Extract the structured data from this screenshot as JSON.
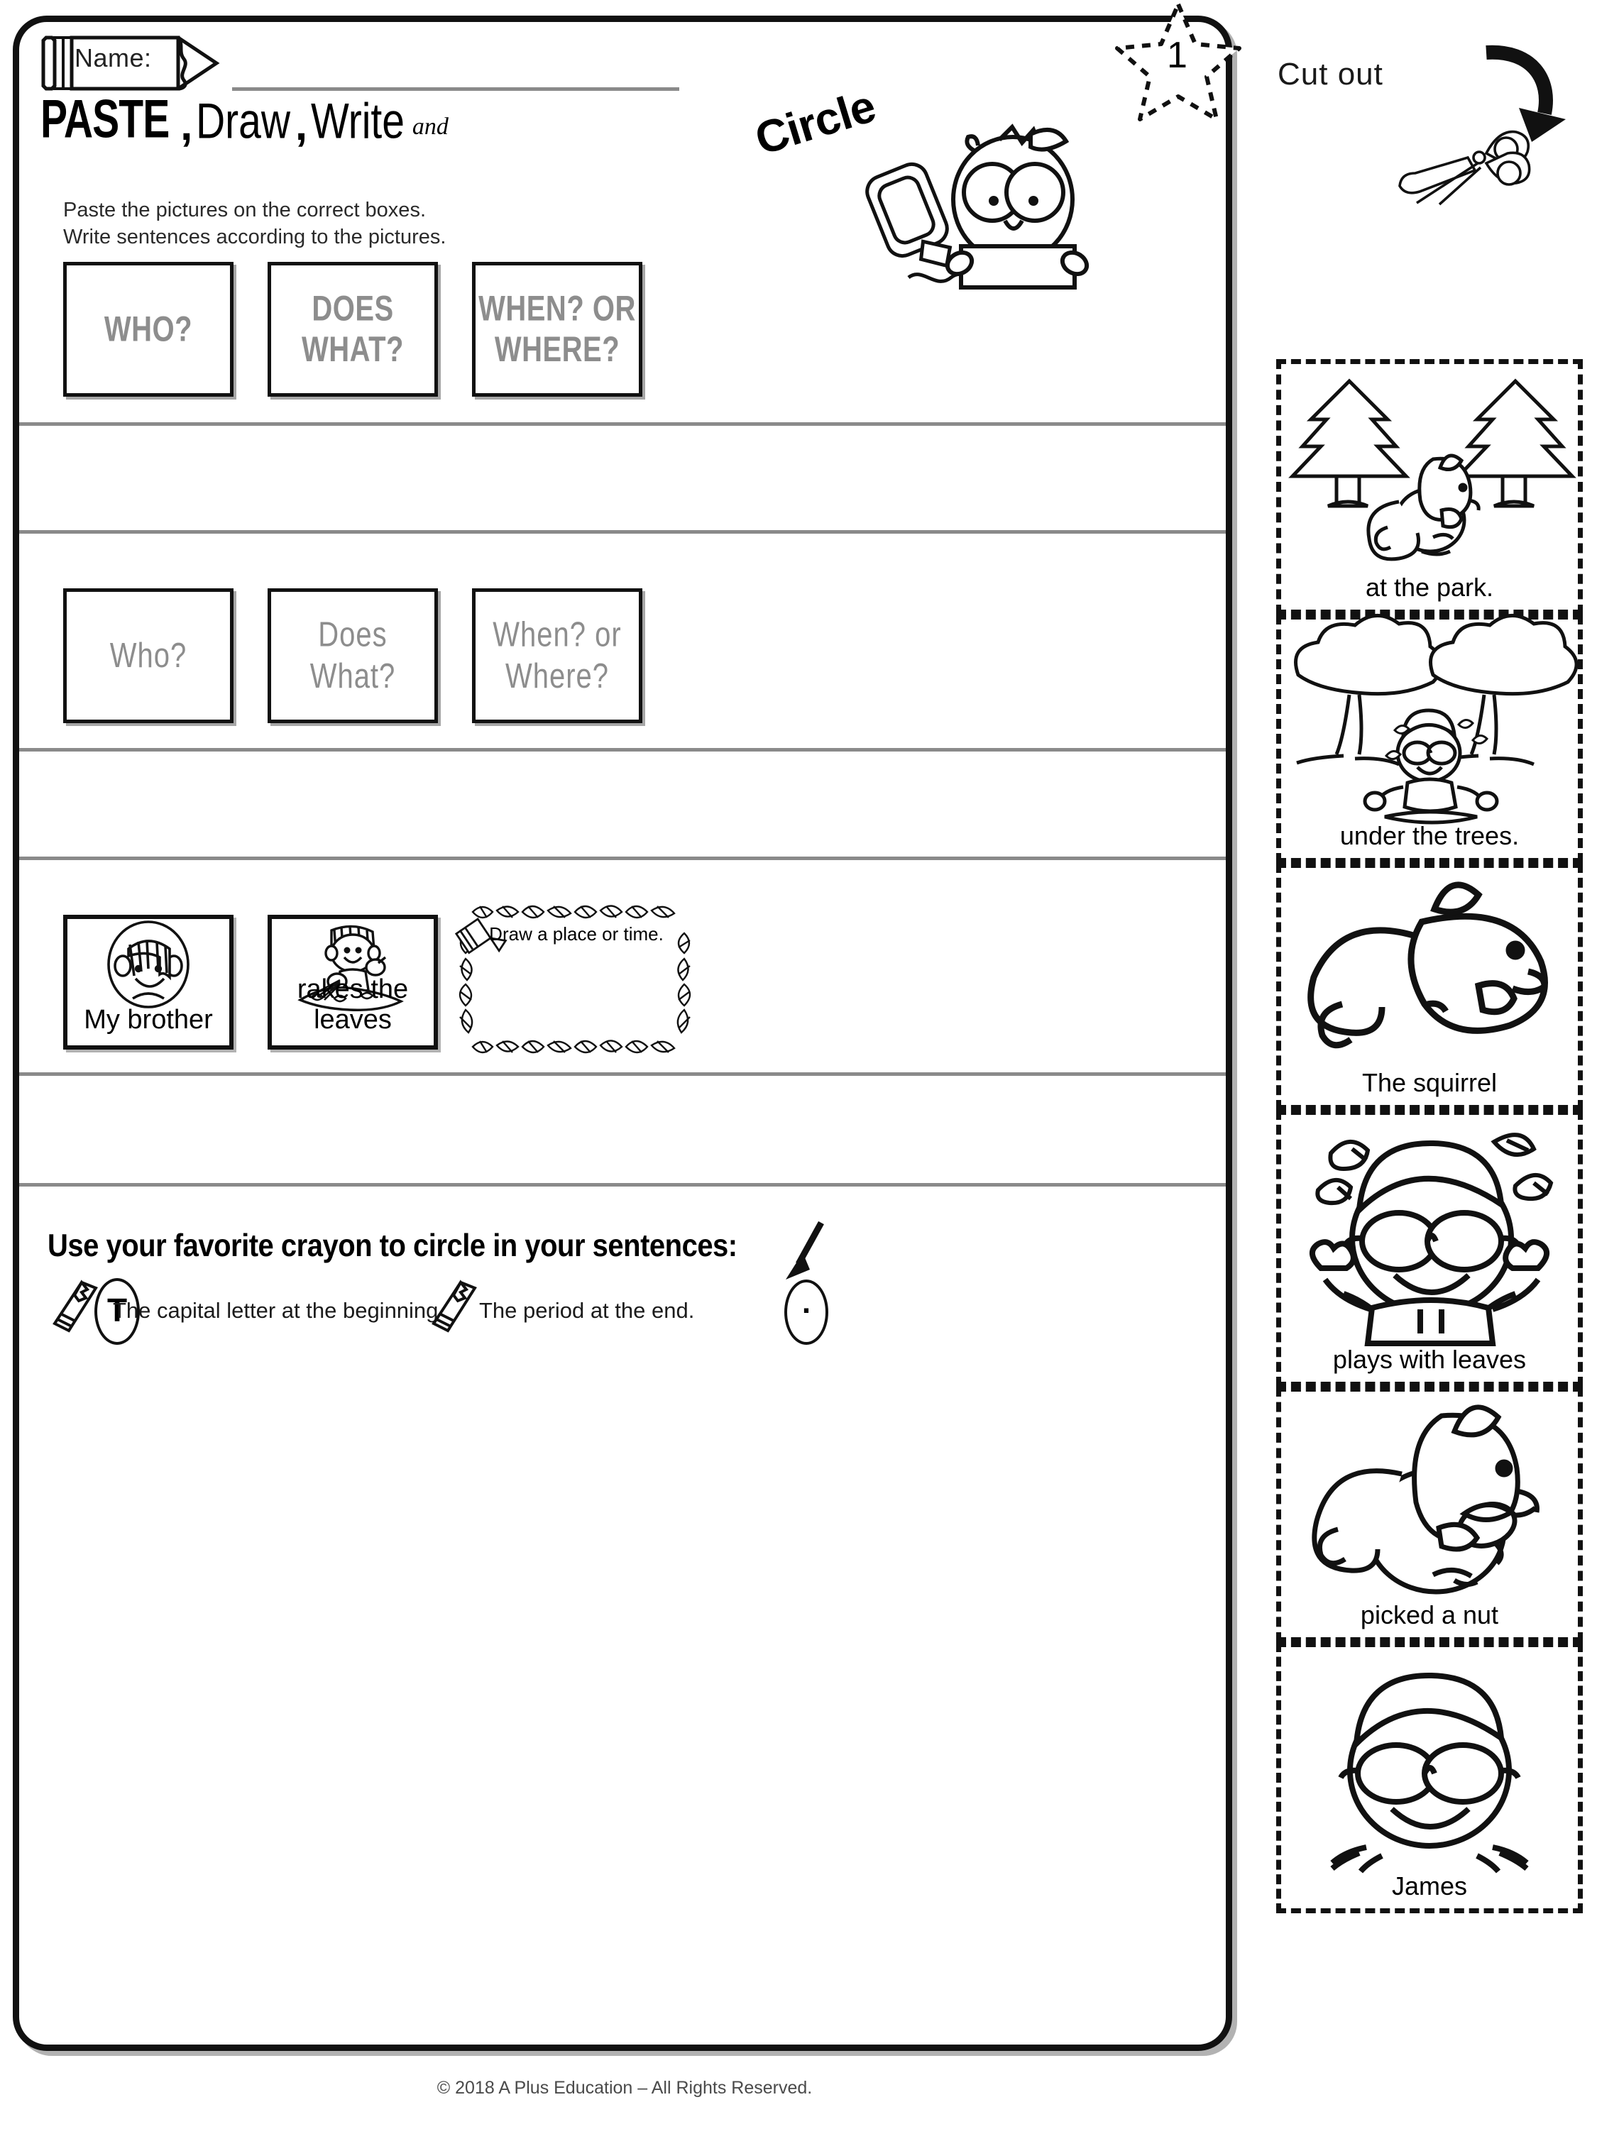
{
  "worksheet": {
    "name_field": {
      "label": "Name:",
      "value": ""
    },
    "title": {
      "word1": "PASTE",
      "comma1": ",",
      "word2": "Draw",
      "comma2": ",",
      "word3": "Write",
      "connector": "and",
      "word4": "Circle"
    },
    "instructions": {
      "line1": "Paste the pictures on the correct boxes.",
      "line2": "Write sentences according to the pictures."
    },
    "page_badge": {
      "number": "1",
      "shape": "star-dashed"
    },
    "category_row_caps": [
      {
        "label": "WHO?"
      },
      {
        "label": "DOES WHAT?"
      },
      {
        "label": "WHEN? OR WHERE?",
        "line1": "WHEN? OR",
        "line2": "WHERE?"
      }
    ],
    "category_row_mixed": [
      {
        "label": "Who?"
      },
      {
        "label": "Does What?"
      },
      {
        "label": "When? or Where?",
        "line1": "When? or",
        "line2": "Where?"
      }
    ],
    "example_row": [
      {
        "caption": "My brother",
        "art": "boy-face-portrait-icon"
      },
      {
        "caption": "rakes the leaves",
        "art": "boy-raking-leaves-icon"
      }
    ],
    "draw_box": {
      "label": "Draw a place or time.",
      "art": "leaf-border-frame-icon"
    },
    "bottom": {
      "title": "Use your favorite crayon to circle in your sentences:",
      "hint1": "The capital letter at the beginning",
      "hint2": "The period at the end.",
      "hint1_circled_glyph": "T",
      "hint2_circled_glyph": "."
    },
    "copyright": "© 2018 A Plus Education – All Rights Reserved.",
    "mascot": "owl-with-glue-bottle-icon"
  },
  "cutout": {
    "heading": "Cut out",
    "arrow": "curved-down-arrow-icon",
    "scissors": "scissors-icon",
    "cards": [
      {
        "caption": "at the park.",
        "art": "two-pine-trees-with-squirrel-icon"
      },
      {
        "caption": "under the trees.",
        "art": "boy-sitting-under-two-trees-icon"
      },
      {
        "caption": "The squirrel",
        "art": "big-squirrel-icon"
      },
      {
        "caption": "plays with leaves",
        "art": "boy-with-glasses-and-leaves-icon"
      },
      {
        "caption": "picked a nut",
        "art": "squirrel-holding-acorn-icon"
      },
      {
        "caption": "James",
        "art": "boy-with-glasses-face-icon"
      }
    ]
  },
  "colors": {
    "ink": "#111111",
    "muted_label": "#8d8d8d",
    "rule_line": "#8a8a8a",
    "paper": "#ffffff"
  }
}
